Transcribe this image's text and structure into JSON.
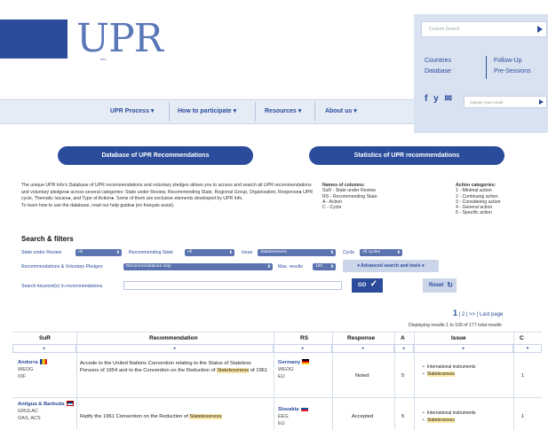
{
  "logo": {
    "text": "UPR",
    "subtext": "info"
  },
  "header": {
    "search_placeholder": "Custom Search",
    "links": [
      "Countries",
      "Database",
      "Follow-Up",
      "Pre-Sessions"
    ],
    "email_placeholder": "register your email",
    "social": [
      "f",
      "y",
      "✉"
    ]
  },
  "nav": {
    "items": [
      "UPR Process ▾",
      "How to participate ▾",
      "Resources ▾",
      "About us ▾"
    ]
  },
  "sections": {
    "database_title": "Database of UPR Recommendations",
    "stats_title": "Statistics of UPR recommendations"
  },
  "intro": {
    "p1": "The unique UPR Info's Database of UPR recommendations and voluntary pledges allows you to access and search all UPR recommendations and voluntary pledges● across several categories: State under Review, Recommending State, Regional Group, Organisation, Response● UPR cycle, Thematic Issues●, and Type of Action●. Some of them are exclusive elements developed by UPR Info.",
    "p2": "To learn how to use the database, read our help guide● (en français aussi)."
  },
  "columns_legend": {
    "title": "Names of columns:",
    "lines": [
      "SuR - State under Review",
      "RS - Recommending State",
      "A - Action",
      "C - Cycle"
    ]
  },
  "action_categories": {
    "title": "Action categories:",
    "lines": [
      "1 - Minimal action",
      "2 - Continuing action",
      "3 - Considering action",
      "4 - General action",
      "5 - Specific action"
    ]
  },
  "filters": {
    "title": "Search & filters",
    "state_label": "State under Review",
    "state_value": "All",
    "rec_state_label": "Recommending State",
    "rec_state_value": "All",
    "issue_label": "Issue",
    "issue_value": "Statelessness",
    "cycle_label": "Cycle",
    "cycle_value": "All cycles",
    "recs_label": "Recommendations & Voluntary Pledges",
    "recs_value": "Recommendations only",
    "max_label": "Max. results",
    "max_value": "100",
    "advanced_label": "▾ Advanced search and tools ▾",
    "keyword_label": "Search keyword(s) in recommendations",
    "go_label": "GO",
    "reset_label": "Reset"
  },
  "pagination": {
    "current": "1",
    "rest": "| 2 |   >>   | Last page",
    "displaying": "Displaying results 1 to 100 of 177 total results"
  },
  "table": {
    "headers": [
      "SuR",
      "Recommendation",
      "RS",
      "Response",
      "A",
      "Issue",
      "C"
    ],
    "rows": [
      {
        "sur": "Andorra",
        "sur_groups": [
          "WEOG",
          "OIF"
        ],
        "rec_pre": "Accede to the United Nations Convention relating to the Status of Stateless Persons of 1954 and to the Convention on the Reduction of",
        "rec_hl": "Statelessness",
        "rec_post": "of 1961",
        "rs": "Germany",
        "rs_groups": [
          "WEOG",
          "EU"
        ],
        "response": "Noted",
        "action": "5",
        "issues": [
          "International instruments",
          "Statelessness"
        ],
        "cycle": "1"
      },
      {
        "sur": "Antigua & Barbuda",
        "sur_groups": [
          "GRULAC",
          "OAS, ACS"
        ],
        "rec_pre": "Ratify the 1961 Convention on the Reduction of",
        "rec_hl": "Statelessness",
        "rec_post": "",
        "rs": "Slovakia",
        "rs_groups": [
          "EEG",
          "EU"
        ],
        "response": "Accepted",
        "action": "5",
        "issues": [
          "International instruments",
          "Statelessness"
        ],
        "cycle": "1"
      }
    ]
  }
}
